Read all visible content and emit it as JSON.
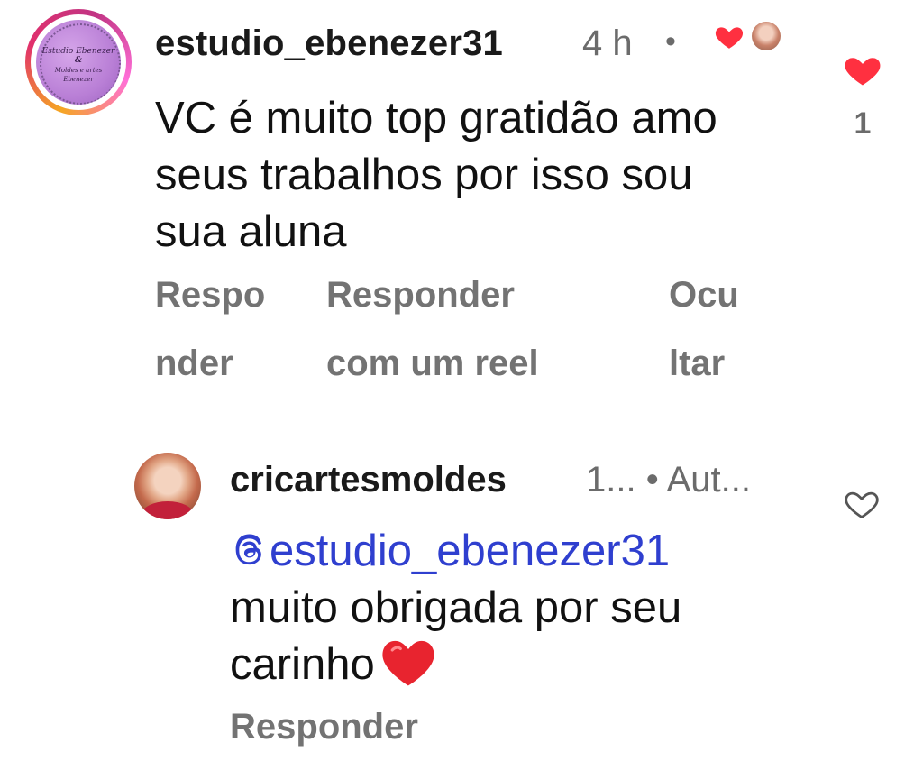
{
  "comment": {
    "username": "estudio_ebenezer31",
    "time": "4 h",
    "separator": "•",
    "avatar_text_top": "Estudio Ebenezer",
    "avatar_text_amp": "&",
    "avatar_text_bottom": "Moldes e artes",
    "avatar_text_bottom2": "Ebenezer",
    "text": "VC é muito top gratidão amo seus trabalhos por isso sou sua aluna",
    "like_count": "1",
    "actions": {
      "reply_line1": "Respo",
      "reply_line2": "nder",
      "reel_line1": "Responder",
      "reel_line2": "com um reel",
      "hide_line1": "Ocu",
      "hide_line2": "ltar"
    }
  },
  "reply": {
    "username": "cricartesmoldes",
    "meta": "1... • Aut...",
    "mention": "estudio_ebenezer31",
    "text": "muito obrigada por seu carinho",
    "reply_label": "Responder"
  },
  "colors": {
    "mention": "#2f3fcf",
    "like": "#ff3040",
    "muted": "#737373"
  },
  "icons": {
    "like": "heart-icon",
    "creator_like": "small-heart-icon",
    "mention": "threads-icon",
    "emoji": "red-heart-emoji"
  }
}
